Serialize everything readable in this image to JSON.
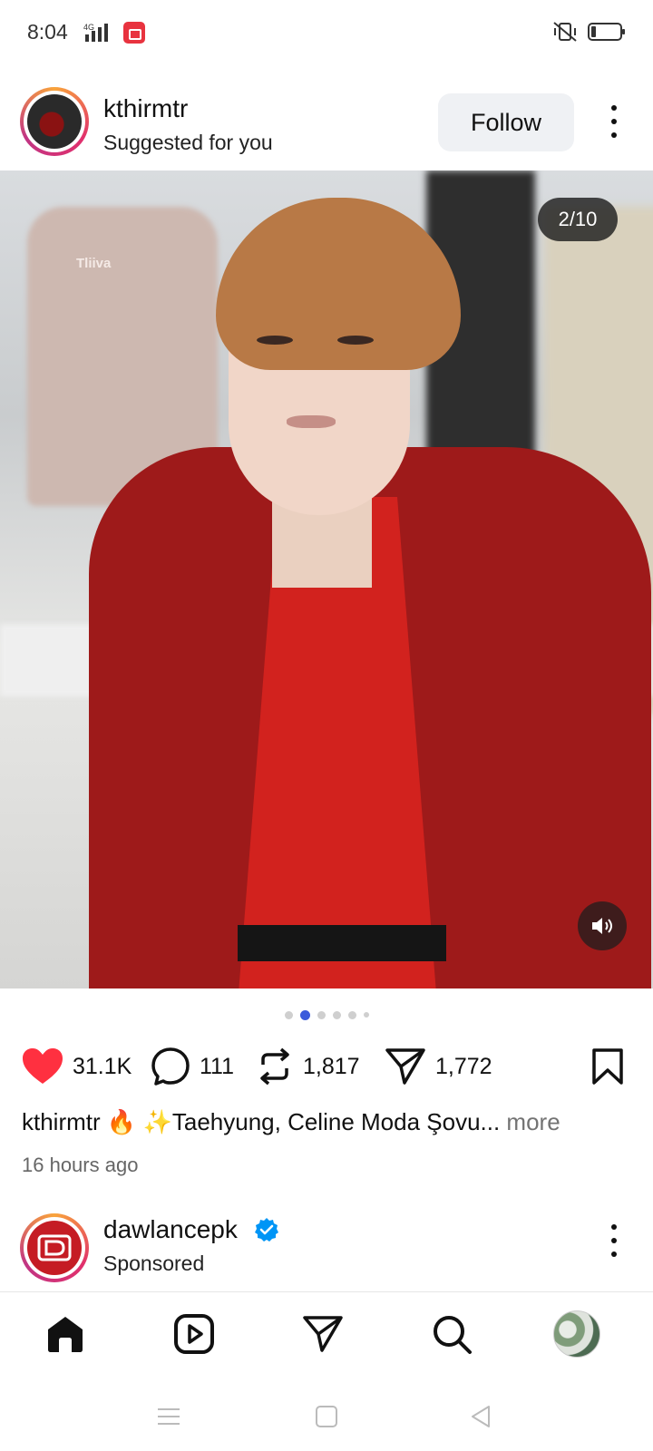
{
  "status_bar": {
    "time": "8:04",
    "network": "4G",
    "icons": [
      "signal-icon",
      "screen-record-icon",
      "mute-vibrate-icon",
      "battery-icon"
    ]
  },
  "post": {
    "username": "kthirmtr",
    "subtitle": "Suggested for you",
    "follow_label": "Follow",
    "slide_counter": "2/10",
    "watermark": "Tliiva",
    "carousel": {
      "total_dots": 6,
      "active_index": 1
    },
    "actions": {
      "likes": "31.1K",
      "comments": "111",
      "reposts": "1,817",
      "shares": "1,772"
    },
    "caption": {
      "username": "kthirmtr",
      "text": " 🔥 ✨Taehyung, Celine Moda Şovu",
      "ellipsis": "...",
      "more_label": " more"
    },
    "timestamp": "16 hours ago"
  },
  "next_post": {
    "username": "dawlancepk",
    "subtitle": "Sponsored",
    "verified": true
  },
  "bottom_nav": {
    "items": [
      "home-icon",
      "reels-icon",
      "direct-message-icon",
      "search-icon",
      "profile-avatar"
    ]
  },
  "colors": {
    "like_red": "#ff3040",
    "accent_blue": "#3b5bdb",
    "verified_blue": "#0095f6",
    "follow_bg": "#eff1f4"
  }
}
